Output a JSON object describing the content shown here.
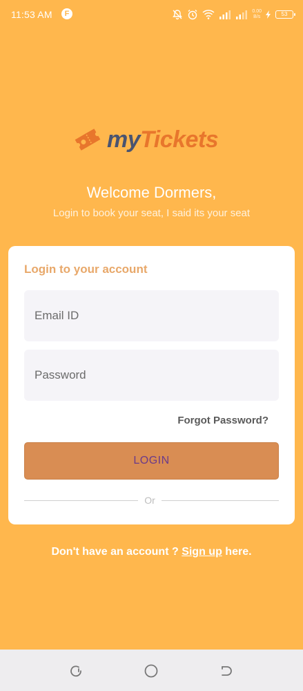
{
  "status_bar": {
    "time": "11:53 AM",
    "app_badge": "F",
    "speed_top": "0.00",
    "speed_bottom": "B/s",
    "battery": "53"
  },
  "logo": {
    "brand_my": "my",
    "brand_tickets": "Tickets",
    "icon": "ticket-icon"
  },
  "welcome": {
    "title": "Welcome Dormers,",
    "subtitle": "Login to book your seat, I said its your seat"
  },
  "login_card": {
    "heading": "Login to your account",
    "email_placeholder": "Email ID",
    "password_placeholder": "Password",
    "forgot_password": "Forgot Password?",
    "login_button": "LOGIN",
    "divider_text": "Or"
  },
  "signup": {
    "prefix": "Don't have an account ? ",
    "link": "Sign up",
    "suffix": " here."
  },
  "nav_bar": {
    "icons": [
      "recent-apps-icon",
      "home-icon",
      "back-icon"
    ]
  },
  "colors": {
    "background": "#FFB74D",
    "accent": "#E8762C",
    "heading": "#E8A86A",
    "button": "#D98D53",
    "button_text": "#6A3A8A",
    "logo_dark": "#4A5470"
  }
}
